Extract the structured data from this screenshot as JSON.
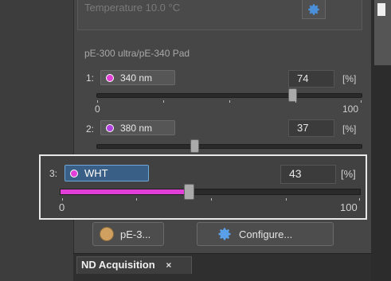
{
  "temperature_text": "Temperature 10.0 °C",
  "section_title": "pE-300 ultra/pE-340 Pad",
  "colors": {
    "magenta": "#e23fd8",
    "violet": "#b23fe0",
    "highlight": "#3a5f86",
    "accent_blue": "#5aa0e8"
  },
  "channels": [
    {
      "index": "1:",
      "label": "340 nm",
      "value": "74",
      "unit": "[%]",
      "level": 74,
      "dot_color": "#e23fd8",
      "scale_min": "0",
      "scale_max": "100"
    },
    {
      "index": "2:",
      "label": "380 nm",
      "value": "37",
      "unit": "[%]",
      "level": 37,
      "dot_color": "#b23fe0"
    },
    {
      "index": "3:",
      "label": "WHT",
      "value": "43",
      "unit": "[%]",
      "level": 43,
      "dot_color": "#e23fd8",
      "scale_min": "0",
      "scale_max": "100"
    }
  ],
  "buttons": {
    "device": "pE-3...",
    "configure": "Configure..."
  },
  "icons": {
    "top_settings": "gear-icon",
    "configure": "gear-icon"
  },
  "tab": {
    "label": "ND Acquisition",
    "close": "×"
  }
}
